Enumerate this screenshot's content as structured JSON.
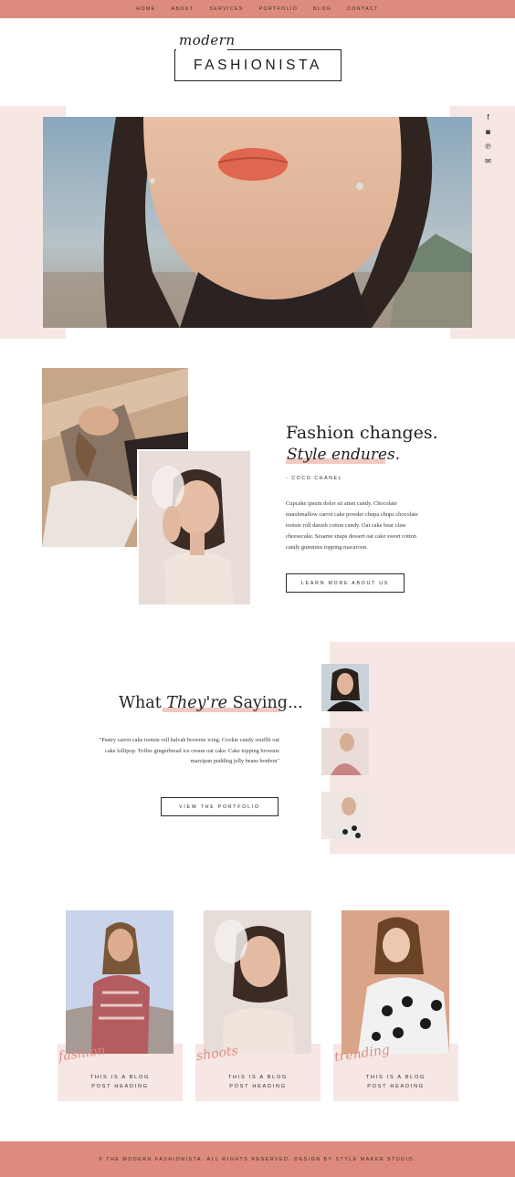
{
  "nav": {
    "items": [
      "HOME",
      "ABOUT",
      "SERVICES",
      "PORTFOLIO",
      "BLOG",
      "CONTACT"
    ]
  },
  "logo": {
    "script": "modern",
    "main": "FASHIONISTA"
  },
  "social": {
    "icons": [
      "facebook-icon",
      "instagram-icon",
      "pinterest-icon",
      "email-icon"
    ],
    "glyphs": [
      "f",
      "◙",
      "℗",
      "✉"
    ]
  },
  "about": {
    "headline_line1": "Fashion changes.",
    "headline_line2": "Style endures.",
    "quote_author": "- COCO CHANEL",
    "body": "Cupcake ipsum dolor sit amet candy. Chocolate marshmallow carrot cake powder chupa chups chocolate tootsie roll danish cotton candy. Oat cake bear claw cheesecake. Sesame snaps dessert oat cake sweet cotton candy gummies topping macaroon.",
    "button_label": "LEARN MORE ABOUT US"
  },
  "testimonials": {
    "heading_part1": "What ",
    "heading_italic": "They're",
    "heading_part2": " Saying...",
    "quote": "\"Pastry carrot cake tootsie roll halvah brownie icing. Cookie candy soufflé oat cake lollipop. Toffee gingerbread ice cream oat cake. Cake topping brownie marzipan pudding jelly beans bonbon\"",
    "button_label": "VIEW THE PORTFOLIO"
  },
  "blog": {
    "posts": [
      {
        "script": "fashion",
        "title_line1": "THIS IS A BLOG",
        "title_line2": "POST HEADING"
      },
      {
        "script": "shoots",
        "title_line1": "THIS IS A BLOG",
        "title_line2": "POST HEADING"
      },
      {
        "script": "trending",
        "title_line1": "THIS IS A BLOG",
        "title_line2": "POST HEADING"
      }
    ]
  },
  "footer": {
    "text": "© THE MODERN FASHIONISTA. ALL RIGHTS RESERVED. DESIGN BY STYLE MAKER STUDIO."
  },
  "colors": {
    "accent": "#dc8b7c",
    "blush": "#f6e6e4",
    "highlight": "#f0c9c2",
    "text": "#2b2b2b"
  }
}
